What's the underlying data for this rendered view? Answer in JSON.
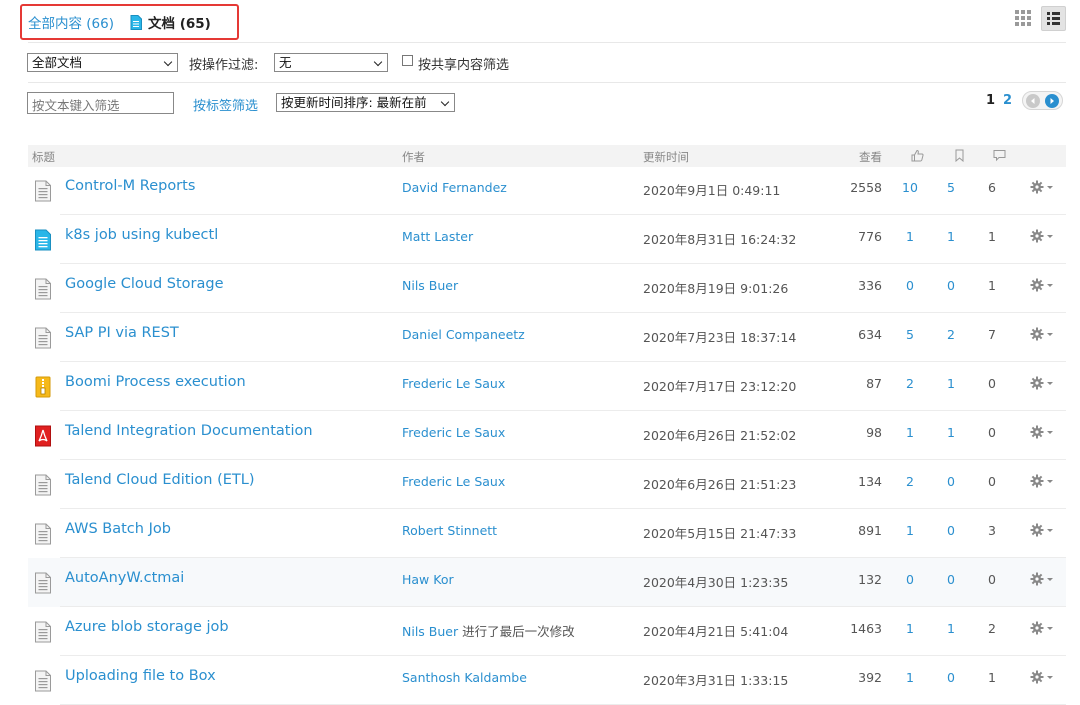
{
  "tabs": {
    "all": "全部内容 (66)",
    "docs": "文档 (65)"
  },
  "filters": {
    "doc_type": "全部文档",
    "action_filter_label": "按操作过滤:",
    "action_filter_value": "无",
    "shared_label": "按共享内容筛选",
    "search_placeholder": "按文本键入筛选",
    "tag_filter_link": "按标签筛选",
    "sort_value": "按更新时间排序: 最新在前"
  },
  "pagination": {
    "current": "1",
    "next": "2"
  },
  "table": {
    "headers": {
      "title": "标题",
      "author": "作者",
      "updated": "更新时间",
      "views": "查看"
    },
    "rows": [
      {
        "icon": "document-icon",
        "title": "Control-M Reports",
        "author": "David Fernandez",
        "edit_note": "",
        "date": "2020年9月1日 0:49:11",
        "views": "2558",
        "likes": "10",
        "bookmarks": "5",
        "comments": "6"
      },
      {
        "icon": "document-blue-icon",
        "title": "k8s job using kubectl",
        "author": "Matt Laster",
        "edit_note": "",
        "date": "2020年8月31日 16:24:32",
        "views": "776",
        "likes": "1",
        "bookmarks": "1",
        "comments": "1"
      },
      {
        "icon": "document-icon",
        "title": "Google Cloud Storage",
        "author": "Nils Buer",
        "edit_note": "",
        "date": "2020年8月19日 9:01:26",
        "views": "336",
        "likes": "0",
        "bookmarks": "0",
        "comments": "1"
      },
      {
        "icon": "document-icon",
        "title": "SAP PI via REST",
        "author": "Daniel Companeetz",
        "edit_note": "",
        "date": "2020年7月23日 18:37:14",
        "views": "634",
        "likes": "5",
        "bookmarks": "2",
        "comments": "7"
      },
      {
        "icon": "zip-file-icon",
        "title": "Boomi Process execution",
        "author": "Frederic Le Saux",
        "edit_note": "",
        "date": "2020年7月17日 23:12:20",
        "views": "87",
        "likes": "2",
        "bookmarks": "1",
        "comments": "0"
      },
      {
        "icon": "pdf-file-icon",
        "title": "Talend Integration Documentation",
        "author": "Frederic Le Saux",
        "edit_note": "",
        "date": "2020年6月26日 21:52:02",
        "views": "98",
        "likes": "1",
        "bookmarks": "1",
        "comments": "0"
      },
      {
        "icon": "document-icon",
        "title": "Talend Cloud Edition (ETL)",
        "author": "Frederic Le Saux",
        "edit_note": "",
        "date": "2020年6月26日 21:51:23",
        "views": "134",
        "likes": "2",
        "bookmarks": "0",
        "comments": "0"
      },
      {
        "icon": "document-icon",
        "title": "AWS Batch Job",
        "author": "Robert Stinnett",
        "edit_note": "",
        "date": "2020年5月15日 21:47:33",
        "views": "891",
        "likes": "1",
        "bookmarks": "0",
        "comments": "3"
      },
      {
        "icon": "document-icon",
        "title": "AutoAnyW.ctmai",
        "author": "Haw Kor",
        "edit_note": "",
        "date": "2020年4月30日 1:23:35",
        "views": "132",
        "likes": "0",
        "bookmarks": "0",
        "comments": "0"
      },
      {
        "icon": "document-icon",
        "title": "Azure blob storage job",
        "author": "Nils Buer",
        "edit_note": "进行了最后一次修改",
        "date": "2020年4月21日 5:41:04",
        "views": "1463",
        "likes": "1",
        "bookmarks": "1",
        "comments": "2"
      },
      {
        "icon": "document-icon",
        "title": "Uploading file to Box",
        "author": "Santhosh Kaldambe",
        "edit_note": "",
        "date": "2020年3月31日 1:33:15",
        "views": "392",
        "likes": "1",
        "bookmarks": "0",
        "comments": "1"
      }
    ]
  },
  "colors": {
    "link": "#2a8fcf",
    "highlight_border": "#e53935"
  }
}
